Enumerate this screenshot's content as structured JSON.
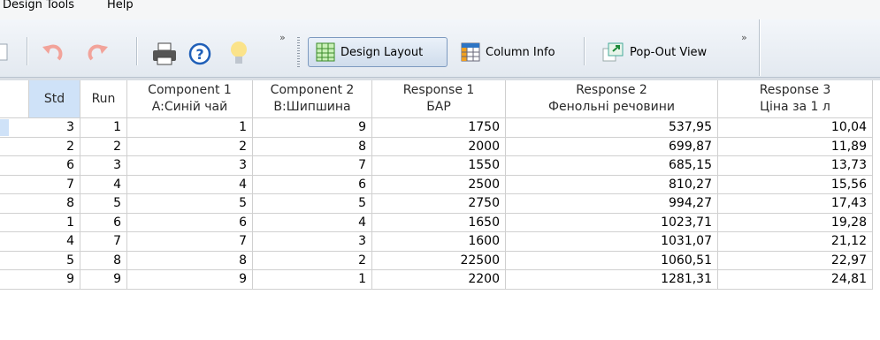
{
  "menu": {
    "items": [
      "Design Tools",
      "Help"
    ]
  },
  "toolbar": {
    "overflow_glyph": "»",
    "buttons": {
      "design_layout": "Design Layout",
      "column_info": "Column Info",
      "popout_view": "Pop-Out View"
    },
    "icons": [
      "undo-icon",
      "redo-icon",
      "print-icon",
      "help-icon",
      "lightbulb-icon",
      "grid-icon",
      "column-info-icon",
      "popout-icon"
    ]
  },
  "table": {
    "headers": [
      {
        "l1": "Std",
        "l2": ""
      },
      {
        "l1": "Run",
        "l2": ""
      },
      {
        "l1": "Component 1",
        "l2": "A:Синій чай"
      },
      {
        "l1": "Component 2",
        "l2": "B:Шипшина"
      },
      {
        "l1": "Response 1",
        "l2": "БАР"
      },
      {
        "l1": "Response 2",
        "l2": "Фенольні речовини"
      },
      {
        "l1": "Response 3",
        "l2": "Ціна за 1 л"
      }
    ],
    "rows": [
      [
        "3",
        "1",
        "1",
        "9",
        "1750",
        "537,95",
        "10,04"
      ],
      [
        "2",
        "2",
        "2",
        "8",
        "2000",
        "699,87",
        "11,89"
      ],
      [
        "6",
        "3",
        "3",
        "7",
        "1550",
        "685,15",
        "13,73"
      ],
      [
        "7",
        "4",
        "4",
        "6",
        "2500",
        "810,27",
        "15,56"
      ],
      [
        "8",
        "5",
        "5",
        "5",
        "2750",
        "994,27",
        "17,43"
      ],
      [
        "1",
        "6",
        "6",
        "4",
        "1650",
        "1023,71",
        "19,28"
      ],
      [
        "4",
        "7",
        "7",
        "3",
        "1600",
        "1031,07",
        "21,12"
      ],
      [
        "5",
        "8",
        "8",
        "2",
        "22500",
        "1060,51",
        "22,97"
      ],
      [
        "9",
        "9",
        "9",
        "1",
        "2200",
        "1281,31",
        "24,81"
      ]
    ]
  },
  "colors": {
    "selected_header": "#cfe2f8",
    "selected_row_marker": "#cfe2f8"
  }
}
